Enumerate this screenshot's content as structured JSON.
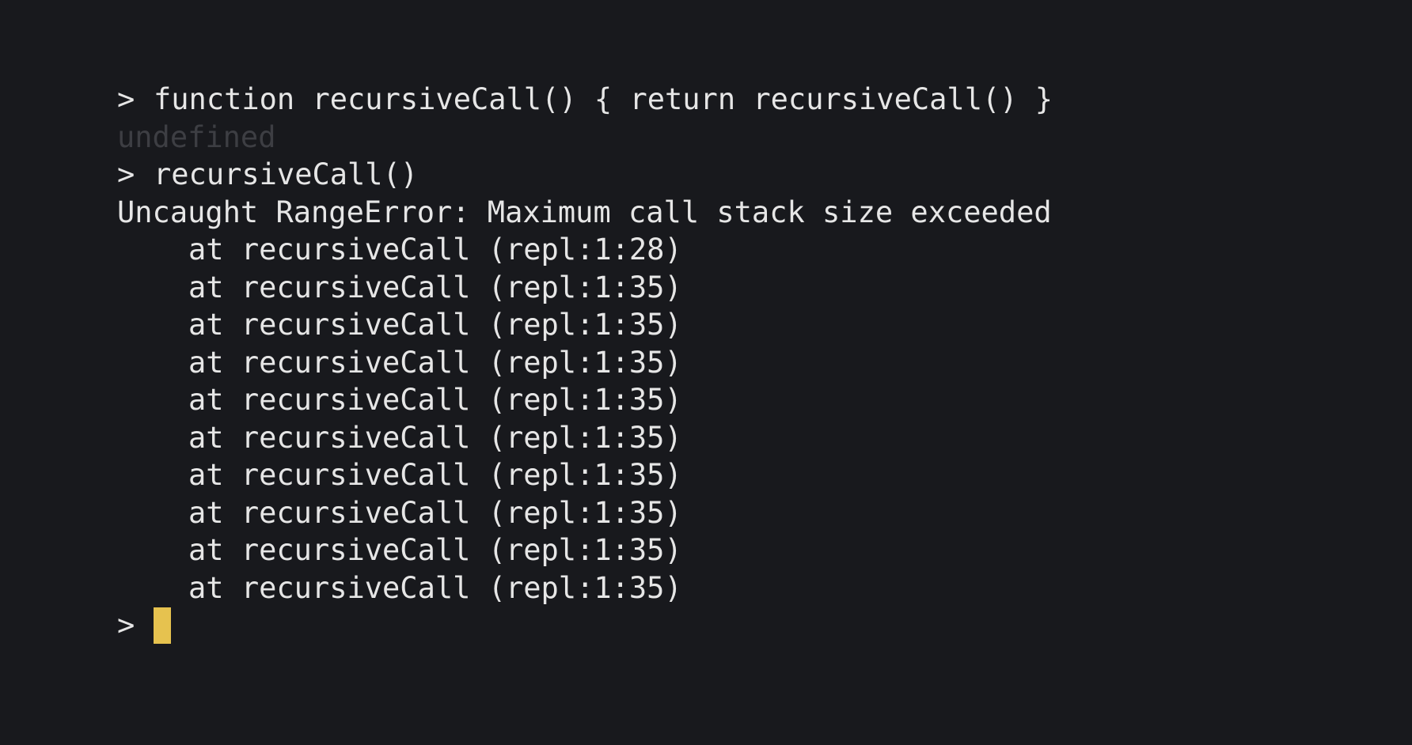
{
  "terminal": {
    "prompt": ">",
    "colors": {
      "background": "#18191d",
      "text": "#e6e6e6",
      "muted": "#3d3e43",
      "cursor": "#e6c24f"
    },
    "lines": [
      {
        "kind": "input",
        "text": "function recursiveCall() { return recursiveCall() }"
      },
      {
        "kind": "result",
        "text": "undefined"
      },
      {
        "kind": "input",
        "text": "recursiveCall()"
      },
      {
        "kind": "error",
        "text": "Uncaught RangeError: Maximum call stack size exceeded"
      }
    ],
    "stack_trace": [
      "at recursiveCall (repl:1:28)",
      "at recursiveCall (repl:1:35)",
      "at recursiveCall (repl:1:35)",
      "at recursiveCall (repl:1:35)",
      "at recursiveCall (repl:1:35)",
      "at recursiveCall (repl:1:35)",
      "at recursiveCall (repl:1:35)",
      "at recursiveCall (repl:1:35)",
      "at recursiveCall (repl:1:35)",
      "at recursiveCall (repl:1:35)"
    ]
  }
}
